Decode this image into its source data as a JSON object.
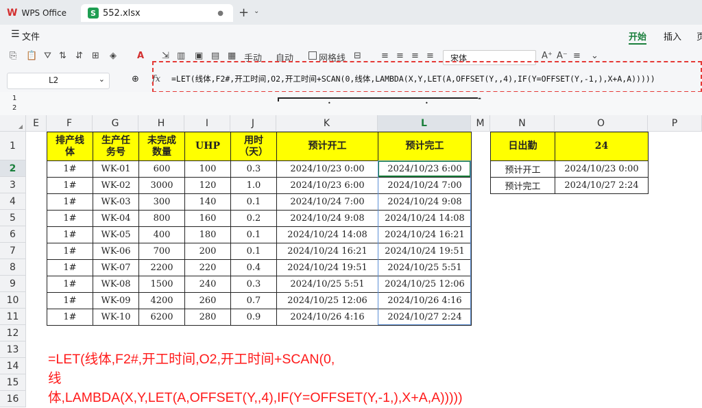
{
  "app": {
    "name": "WPS Office",
    "file_tab": "552.xlsx"
  },
  "menu": {
    "file": "文件",
    "tabs": [
      "开始",
      "插入",
      "页"
    ]
  },
  "toolbar": {
    "manual": "手动",
    "auto": "自动",
    "gridlines": "网格线",
    "font": "宋体"
  },
  "formula_bar": {
    "name_box": "L2",
    "fx": "fx",
    "formula": "=LET(线体,F2#,开工时间,O2,开工时间+SCAN(0,线体,LAMBDA(X,Y,LET(A,OFFSET(Y,,4),IF(Y=OFFSET(Y,-1,),X+A,A)))))"
  },
  "outline_levels": [
    "1",
    "2"
  ],
  "column_headers": [
    "E",
    "F",
    "G",
    "H",
    "I",
    "J",
    "K",
    "L",
    "M",
    "N",
    "O",
    "P"
  ],
  "row_headers": [
    "1",
    "2",
    "3",
    "4",
    "5",
    "6",
    "7",
    "8",
    "9",
    "10",
    "11",
    "12",
    "13",
    "14",
    "15",
    "16"
  ],
  "selected_cell": {
    "column": "L",
    "row": "2"
  },
  "table": {
    "headers": [
      "排产线体",
      "生产任务号",
      "未完成数量",
      "UHP",
      "用时（天）",
      "预计开工",
      "预计完工"
    ],
    "rows": [
      [
        "1#",
        "WK-01",
        "600",
        "100",
        "0.3",
        "2024/10/23 0:00",
        "2024/10/23 6:00"
      ],
      [
        "1#",
        "WK-02",
        "3000",
        "120",
        "1.0",
        "2024/10/23 6:00",
        "2024/10/24 7:00"
      ],
      [
        "1#",
        "WK-03",
        "300",
        "140",
        "0.1",
        "2024/10/24 7:00",
        "2024/10/24 9:08"
      ],
      [
        "1#",
        "WK-04",
        "800",
        "160",
        "0.2",
        "2024/10/24 9:08",
        "2024/10/24 14:08"
      ],
      [
        "1#",
        "WK-05",
        "400",
        "180",
        "0.1",
        "2024/10/24 14:08",
        "2024/10/24 16:21"
      ],
      [
        "1#",
        "WK-06",
        "700",
        "200",
        "0.1",
        "2024/10/24 16:21",
        "2024/10/24 19:51"
      ],
      [
        "1#",
        "WK-07",
        "2200",
        "220",
        "0.4",
        "2024/10/24 19:51",
        "2024/10/25 5:51"
      ],
      [
        "1#",
        "WK-08",
        "1500",
        "240",
        "0.3",
        "2024/10/25 5:51",
        "2024/10/25 12:06"
      ],
      [
        "1#",
        "WK-09",
        "4200",
        "260",
        "0.7",
        "2024/10/25 12:06",
        "2024/10/26 4:16"
      ],
      [
        "1#",
        "WK-10",
        "6200",
        "280",
        "0.9",
        "2024/10/26 4:16",
        "2024/10/27 2:24"
      ]
    ]
  },
  "side_table": {
    "header": [
      "日出勤",
      "24"
    ],
    "rows": [
      [
        "预计开工",
        "2024/10/23 0:00"
      ],
      [
        "预计完工",
        "2024/10/27 2:24"
      ]
    ]
  },
  "big_formula": "=LET(线体,F2#,开工时间,O2,开工时间+SCAN(0,线体,LAMBDA(X,Y,LET(A,OFFSET(Y,,4),IF(Y=OFFSET(Y,-1,),X+A,A)))))"
}
